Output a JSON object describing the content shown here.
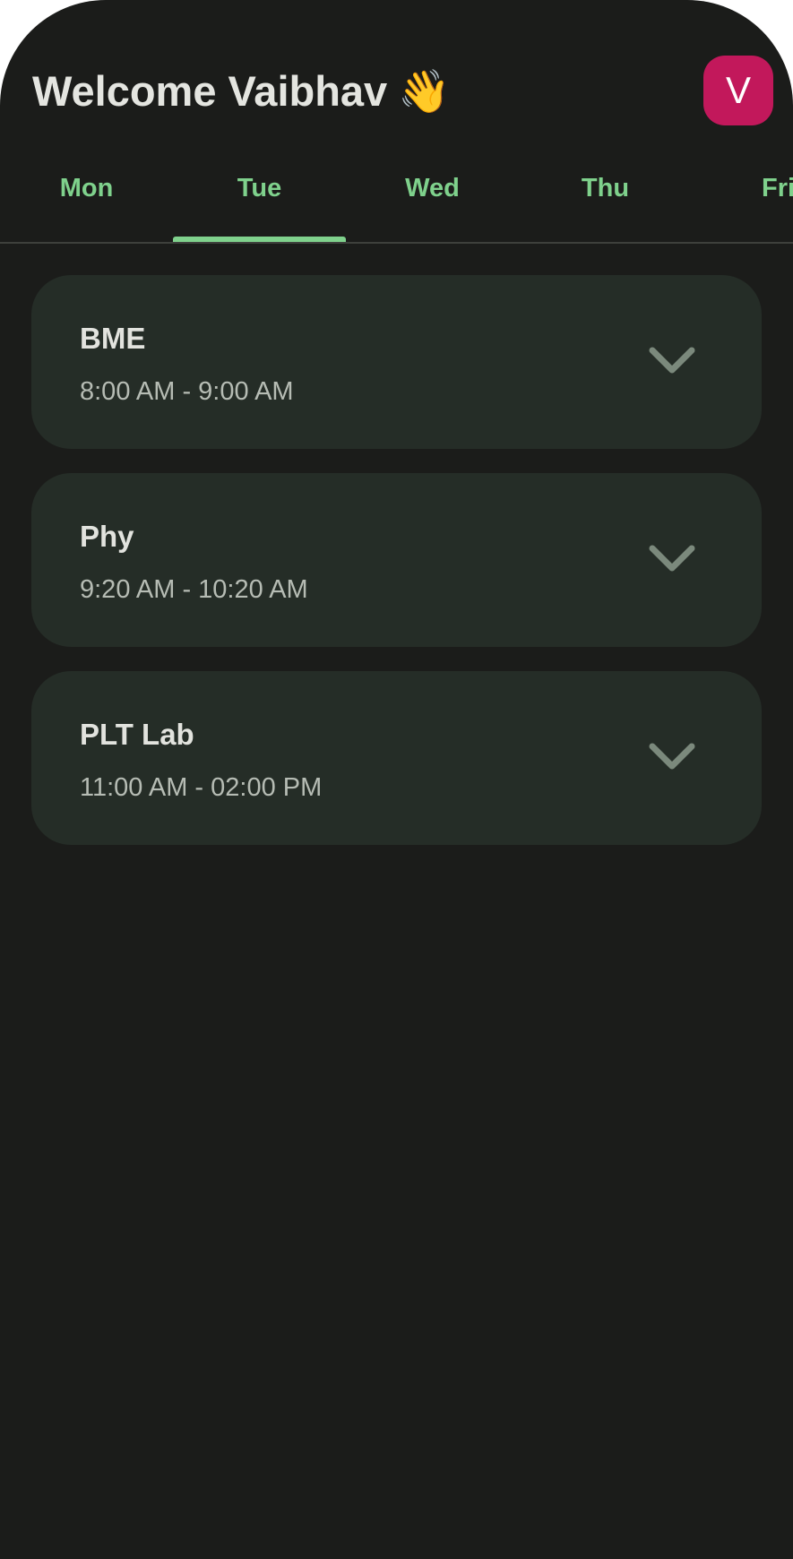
{
  "header": {
    "greeting": "Welcome Vaibhav",
    "emoji": "👋",
    "avatar_letter": "V"
  },
  "tabs": [
    {
      "label": "Mon",
      "active": false
    },
    {
      "label": "Tue",
      "active": true
    },
    {
      "label": "Wed",
      "active": false
    },
    {
      "label": "Thu",
      "active": false
    },
    {
      "label": "Fri",
      "active": false
    }
  ],
  "classes": [
    {
      "title": "BME",
      "time": "8:00 AM - 9:00 AM",
      "icon": "chevron-down-icon"
    },
    {
      "title": "Phy",
      "time": "9:20 AM - 10:20 AM",
      "icon": "chevron-down-icon"
    },
    {
      "title": "PLT Lab",
      "time": "11:00 AM - 02:00 PM",
      "icon": "chevron-down-icon"
    }
  ],
  "colors": {
    "background": "#1b1c1a",
    "card": "#252d27",
    "accent": "#7fd18c",
    "avatar": "#c2185b"
  }
}
